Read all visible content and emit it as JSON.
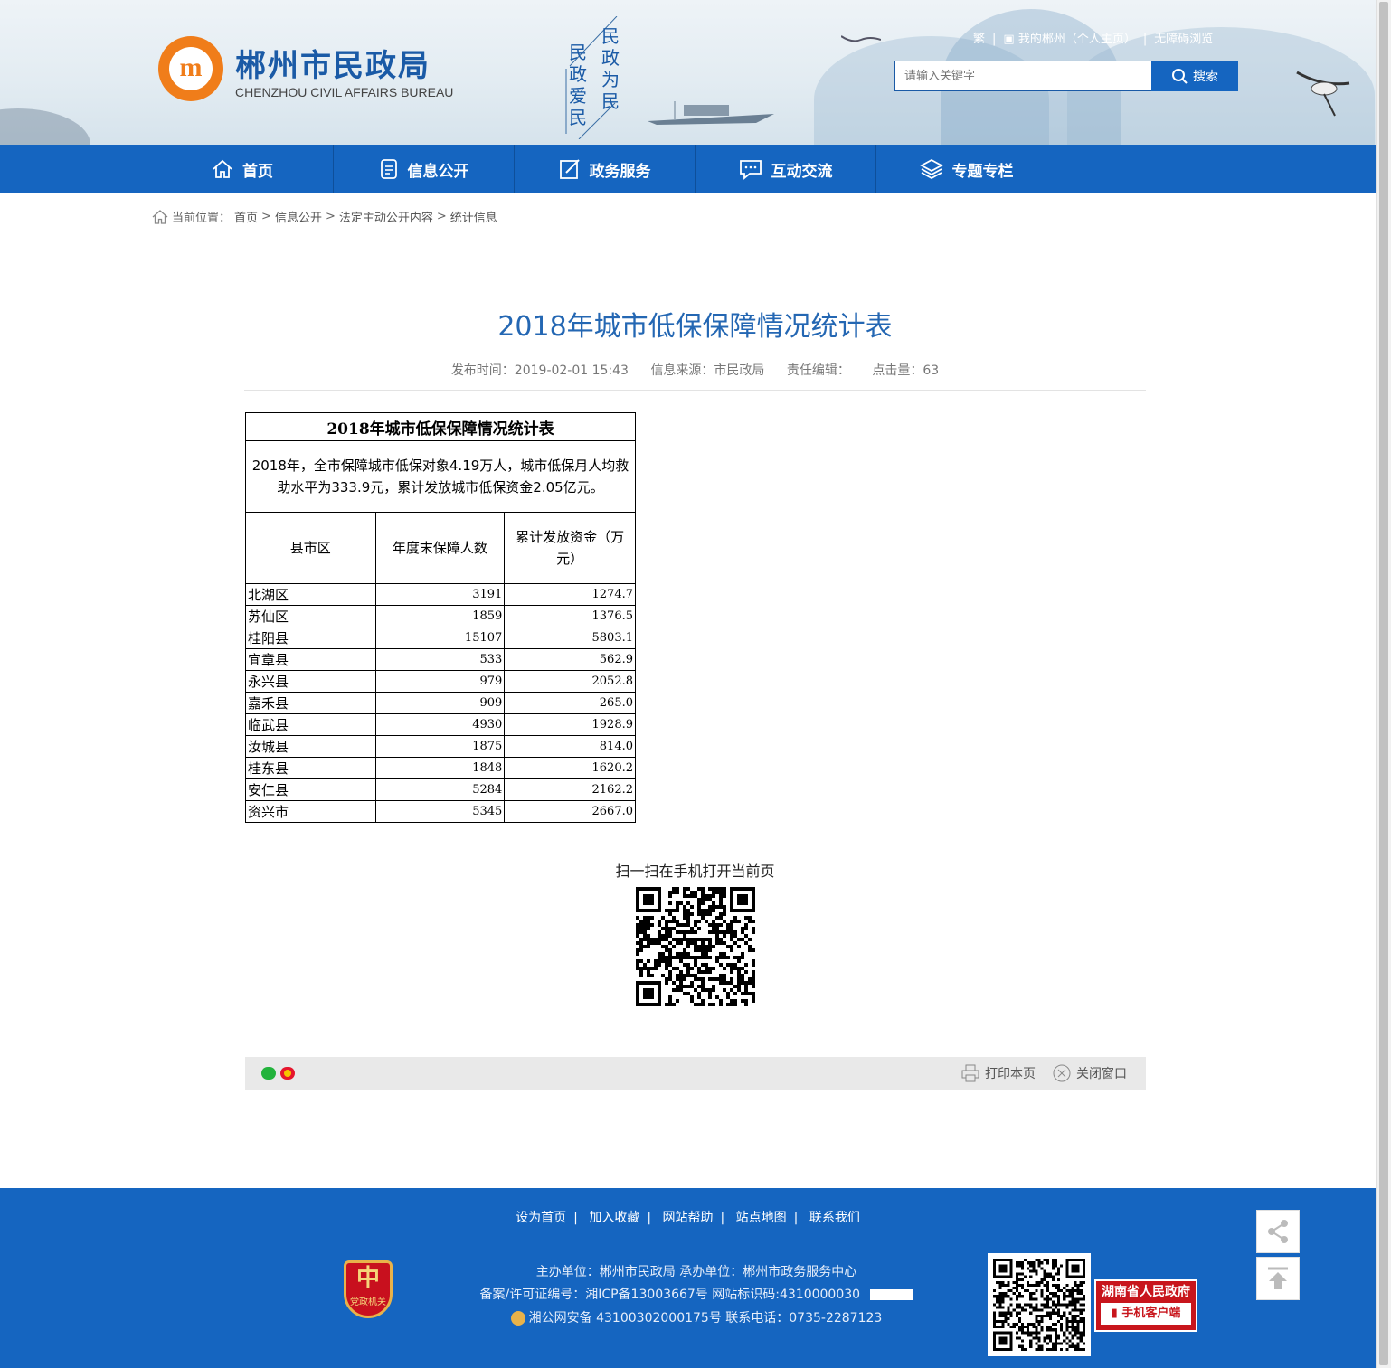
{
  "header": {
    "site_name": "郴州市民政局",
    "site_name_en": "CHENZHOU CIVIL AFFAIRS BUREAU",
    "slogan_right": "民政为民",
    "slogan_left": "民政爱民",
    "top_links": {
      "traditional": "繁",
      "my_chenzhou": "我的郴州（个人主页）",
      "accessible": "无障碍浏览"
    },
    "search": {
      "placeholder": "请输入关键字",
      "button": "搜索"
    },
    "colors": {
      "brand_blue": "#1565c0",
      "logo_orange": "#f07d1a"
    }
  },
  "nav": {
    "items": [
      {
        "label": "首页",
        "icon": "home-icon"
      },
      {
        "label": "信息公开",
        "icon": "document-icon"
      },
      {
        "label": "政务服务",
        "icon": "edit-icon"
      },
      {
        "label": "互动交流",
        "icon": "chat-icon"
      },
      {
        "label": "专题专栏",
        "icon": "layers-icon"
      }
    ]
  },
  "breadcrumb": {
    "prefix": "当前位置：",
    "items": [
      "首页",
      "信息公开",
      "法定主动公开内容",
      "统计信息"
    ],
    "separator": ">"
  },
  "article": {
    "title": "2018年城市低保保障情况统计表",
    "meta": {
      "publish_time": "发布时间：2019-02-01 15:43",
      "source": "信息来源：市民政局",
      "editor": "责任编辑：",
      "clicks": "点击量：63"
    }
  },
  "table": {
    "caption": "2018年城市低保保障情况统计表",
    "summary": "2018年，全市保障城市低保对象4.19万人，城市低保月人均救助水平为333.9元，累计发放城市低保资金2.05亿元。",
    "headers": [
      "县市区",
      "年度末保障人数",
      "累计发放资金（万元）"
    ],
    "rows": [
      [
        "北湖区",
        "3191",
        "1274.7"
      ],
      [
        "苏仙区",
        "1859",
        "1376.5"
      ],
      [
        "桂阳县",
        "15107",
        "5803.1"
      ],
      [
        "宜章县",
        "533",
        "562.9"
      ],
      [
        "永兴县",
        "979",
        "2052.8"
      ],
      [
        "嘉禾县",
        "909",
        "265.0"
      ],
      [
        "临武县",
        "4930",
        "1928.9"
      ],
      [
        "汝城县",
        "1875",
        "814.0"
      ],
      [
        "桂东县",
        "1848",
        "1620.2"
      ],
      [
        "安仁县",
        "5284",
        "2162.2"
      ],
      [
        "资兴市",
        "5345",
        "2667.0"
      ]
    ]
  },
  "qr": {
    "caption": "扫一扫在手机打开当前页"
  },
  "share_bar": {
    "print": "打印本页",
    "close": "关闭窗口"
  },
  "footer": {
    "links": [
      "设为首页",
      "加入收藏",
      "网站帮助",
      "站点地图",
      "联系我们"
    ],
    "host": "主办单位：郴州市民政局   承办单位：郴州市政务服务中心",
    "icp": "备案/许可证编号：湘ICP备13003667号    网站标识码:4310000030",
    "police": "湘公网安备 43100302000175号   联系电话：0735-2287123",
    "badge_text": "党政机关",
    "gov_app": {
      "line1": "湖南省人民政府",
      "line2": "手机客户端"
    }
  }
}
